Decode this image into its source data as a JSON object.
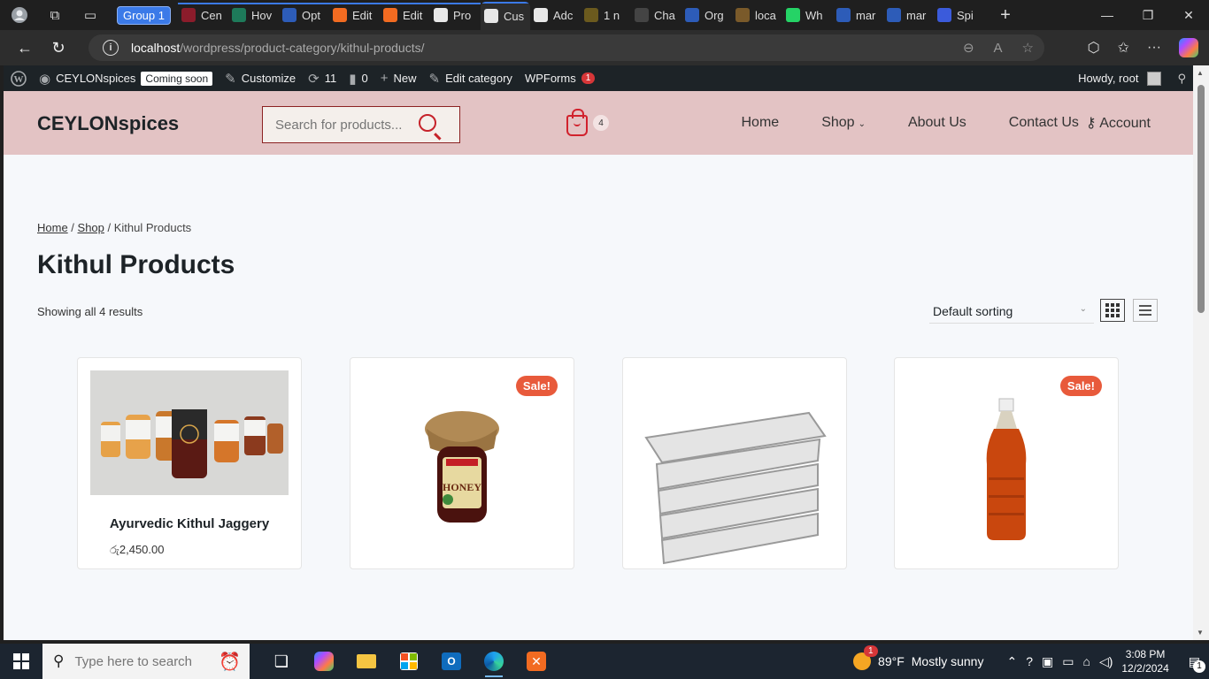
{
  "browser": {
    "group_label": "Group 1",
    "tabs": [
      {
        "label": "Cen",
        "color": "#8b1c2b"
      },
      {
        "label": "Hov",
        "color": "#1e7a5a"
      },
      {
        "label": "Opt",
        "color": "#2d5cb8"
      },
      {
        "label": "Edit",
        "color": "#f26b21"
      },
      {
        "label": "Edit",
        "color": "#f26b21"
      },
      {
        "label": "Pro",
        "color": "#e8e8e8"
      },
      {
        "label": "Cus",
        "color": "#e8e8e8"
      },
      {
        "label": "Adc",
        "color": "#e8e8e8"
      },
      {
        "label": "1 n",
        "color": "#6b5a1e"
      },
      {
        "label": "Cha",
        "color": "#444444"
      },
      {
        "label": "Org",
        "color": "#2d5cb8"
      },
      {
        "label": "loca",
        "color": "#7a5a2a"
      },
      {
        "label": "Wh",
        "color": "#25d366"
      },
      {
        "label": "mar",
        "color": "#2d5cb8"
      },
      {
        "label": "mar",
        "color": "#2d5cb8"
      },
      {
        "label": "Spi",
        "color": "#3b5bdb"
      }
    ],
    "url_host": "localhost",
    "url_path": "/wordpress/product-category/kithul-products/"
  },
  "wp_admin_bar": {
    "site_name": "CEYLONspices",
    "coming_soon": "Coming soon",
    "customize": "Customize",
    "updates": "11",
    "comments": "0",
    "new": "New",
    "edit_category": "Edit category",
    "wpforms": "WPForms",
    "wpforms_badge": "1",
    "howdy": "Howdy, root"
  },
  "header": {
    "logo": "CEYLONspices",
    "search_placeholder": "Search for products...",
    "cart_count": "4",
    "nav": [
      "Home",
      "Shop",
      "About Us",
      "Contact Us",
      "Account"
    ]
  },
  "breadcrumb": {
    "home": "Home",
    "shop": "Shop",
    "current": "Kithul Products"
  },
  "page_title": "Kithul Products",
  "results_text": "Showing all 4 results",
  "sorting": "Default sorting",
  "products": [
    {
      "title": "Ayurvedic Kithul Jaggery",
      "price": "රු2,450.00",
      "sale": ""
    },
    {
      "title": "",
      "price": "",
      "sale": "Sale!"
    },
    {
      "title": "",
      "price": "",
      "sale": ""
    },
    {
      "title": "",
      "price": "",
      "sale": "Sale!"
    }
  ],
  "taskbar": {
    "search_placeholder": "Type here to search",
    "weather_temp": "89°F",
    "weather_desc": "Mostly sunny",
    "weather_badge": "1",
    "time": "3:08 PM",
    "date": "12/2/2024",
    "notif_count": "1"
  },
  "colors": {
    "accent": "#d1222d",
    "header_bg": "#e3c3c4",
    "sale_badge": "#e85a3b"
  }
}
